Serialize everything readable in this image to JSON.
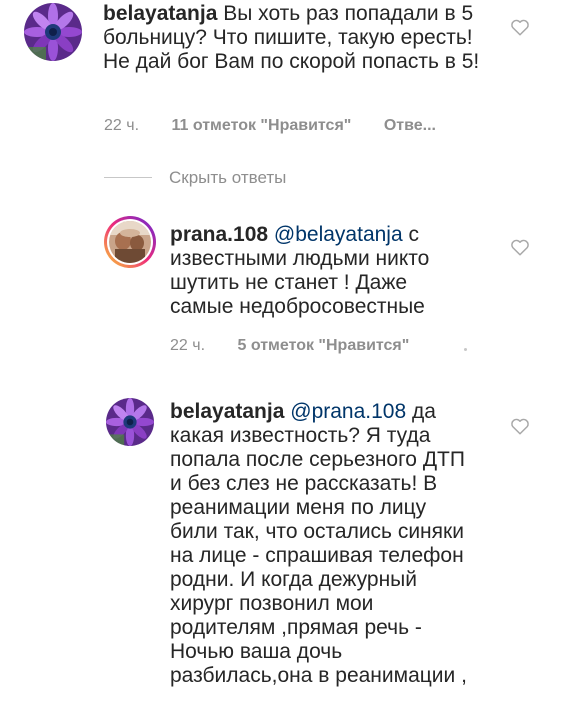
{
  "comments": [
    {
      "username": "belayatanja",
      "mention": "",
      "text": "Вы хоть раз попадали в 5 больницу? Что пишите, такую ересть! Не дай бог Вам по скорой попасть в 5!",
      "time": "22 ч.",
      "likes": "11 отметок \"Нравится\"",
      "reply": "Отве..."
    },
    {
      "username": "prana.108",
      "mention": "@belayatanja",
      "text": "с известными людьми никто шутить не станет ! Даже самые недобросовестные",
      "time": "22 ч.",
      "likes": "5 отметок \"Нравится\"",
      "reply": ""
    },
    {
      "username": "belayatanja",
      "mention": "@prana.108",
      "text": "да какая известность? Я туда попала после серьезного ДТП и без слез не рассказать! В реанимации меня по лицу били так, что остались синяки на лице - спрашивая телефон родни. И когда дежурный хирург позвонил мои родителям ,прямая речь - Ночью ваша дочь разбилась,она в реанимации ,",
      "time": "",
      "likes": "",
      "reply": ""
    }
  ],
  "hide_replies_label": "Скрыть ответы",
  "icons": {
    "like": "heart-outline-icon"
  },
  "colors": {
    "text": "#262626",
    "meta": "#8e8e8e",
    "mention": "#003569",
    "avatar_purple": "#8a3fc4",
    "story_ring": "#d62976"
  }
}
